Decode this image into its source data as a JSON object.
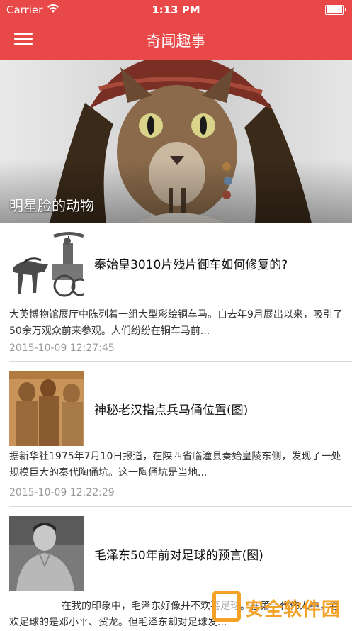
{
  "status_bar": {
    "carrier": "Carrier",
    "time": "1:13 PM",
    "battery_level": 1.0
  },
  "nav": {
    "title": "奇闻趣事",
    "menu_icon": "hamburger-menu-icon"
  },
  "hero": {
    "caption": "明星脸的动物",
    "image": "cat-as-pirate-photo"
  },
  "news": [
    {
      "title": "秦始皇3010片残片御车如何修复的?",
      "summary": "大英博物馆展厅中陈列着一组大型彩绘铜车马。自去年9月展出以来，吸引了50余万观众前来参观。人们纷纷在铜车马前...",
      "time": "2015-10-09 12:27:45",
      "image": "bronze-chariot-photo"
    },
    {
      "title": "神秘老汉指点兵马俑位置(图)",
      "summary": "据新华社1975年7月10日报道，在陕西省临潼县秦始皇陵东侧，发现了一处规模巨大的秦代陶俑坑。这一陶俑坑是当地...",
      "time": "2015-10-09 12:22:29",
      "image": "terracotta-warriors-photo"
    },
    {
      "title": "毛泽东50年前对足球的预言(图)",
      "summary": "在我的印象中，毛泽东好像并不欢喜足球。在第一代伟人中，喜欢足球的是邓小平、贺龙。但毛泽东却对足球发...",
      "time": "",
      "image": "portrait-photo"
    }
  ],
  "watermark": {
    "text": "安全软件园"
  },
  "colors": {
    "header_bg": "#e84848",
    "watermark": "#f4a227"
  }
}
